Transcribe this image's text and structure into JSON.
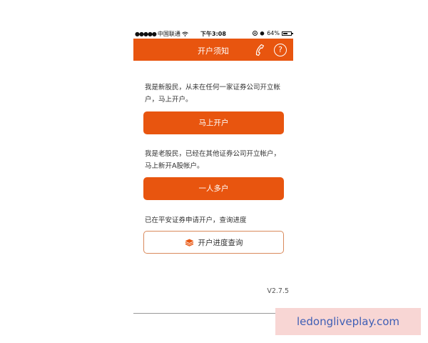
{
  "statusbar": {
    "signal_dots": "●●●●●",
    "carrier": "中国联通",
    "wifi_icon": "wifi-icon",
    "time": "下午3:08",
    "battery_percent": "64%",
    "battery_level": 0.64
  },
  "navbar": {
    "title": "开户须知",
    "icons": [
      "phone-icon",
      "help-icon"
    ],
    "help_glyph": "?"
  },
  "sections": {
    "new_investor_text": "我是新股民，从未在任何一家证券公司开立帐户，马上开户。",
    "new_investor_button": "马上开户",
    "old_investor_text": "我是老股民，已经在其他证券公司开立帐户，马上新开A股帐户。",
    "old_investor_button": "一人多户",
    "progress_text": "已在平安证券申请开户，查询进度",
    "progress_button": "开户进度查询"
  },
  "footer": {
    "version": "V2.7.5"
  },
  "watermark": {
    "text": "ledongliveplay.com"
  },
  "colors": {
    "brand_orange": "#e8550f",
    "outline_border": "#d98a5c",
    "watermark_bg": "#f8d6d4",
    "watermark_text": "#3f5fb5"
  }
}
